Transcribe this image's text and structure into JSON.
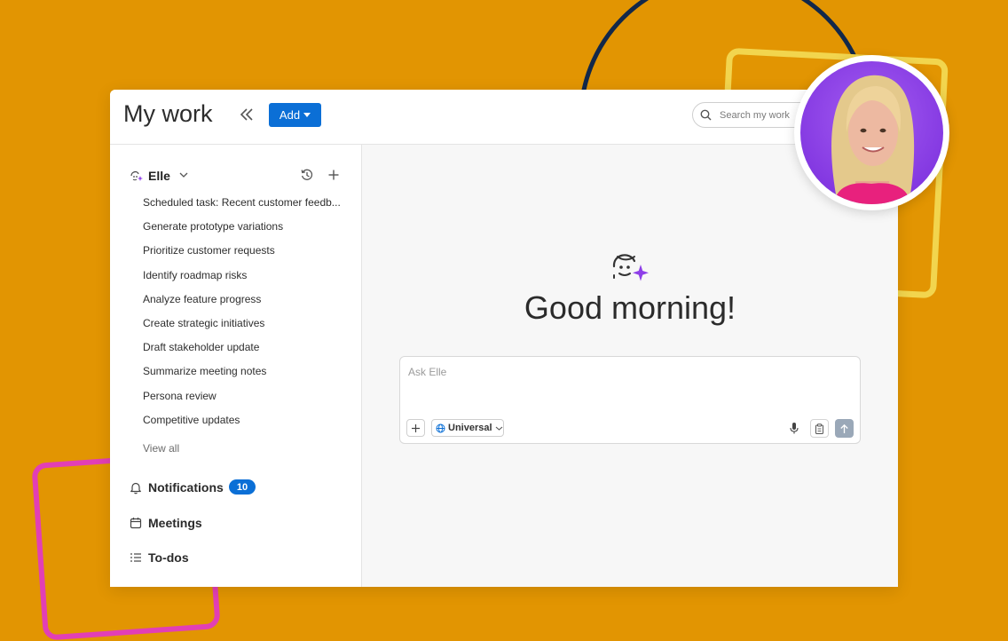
{
  "header": {
    "title": "My work",
    "add_label": "Add",
    "search_placeholder": "Search my work"
  },
  "sidebar": {
    "agent_name": "Elle",
    "tasks": [
      "Scheduled task: Recent customer feedb...",
      "Generate prototype variations",
      "Prioritize customer requests",
      "Identify roadmap risks",
      "Analyze feature progress",
      "Create strategic initiatives",
      "Draft stakeholder update",
      "Summarize meeting notes",
      "Persona review",
      "Competitive updates"
    ],
    "view_all": "View all",
    "nav": {
      "notifications": "Notifications",
      "notifications_count": "10",
      "meetings": "Meetings",
      "todos": "To-dos"
    }
  },
  "main": {
    "greeting": "Good morning!",
    "ask_placeholder": "Ask Elle",
    "scope": "Universal"
  },
  "colors": {
    "background": "#E29502",
    "accent": "#0B6FD6",
    "avatar_bg": "#8E3FE8"
  }
}
